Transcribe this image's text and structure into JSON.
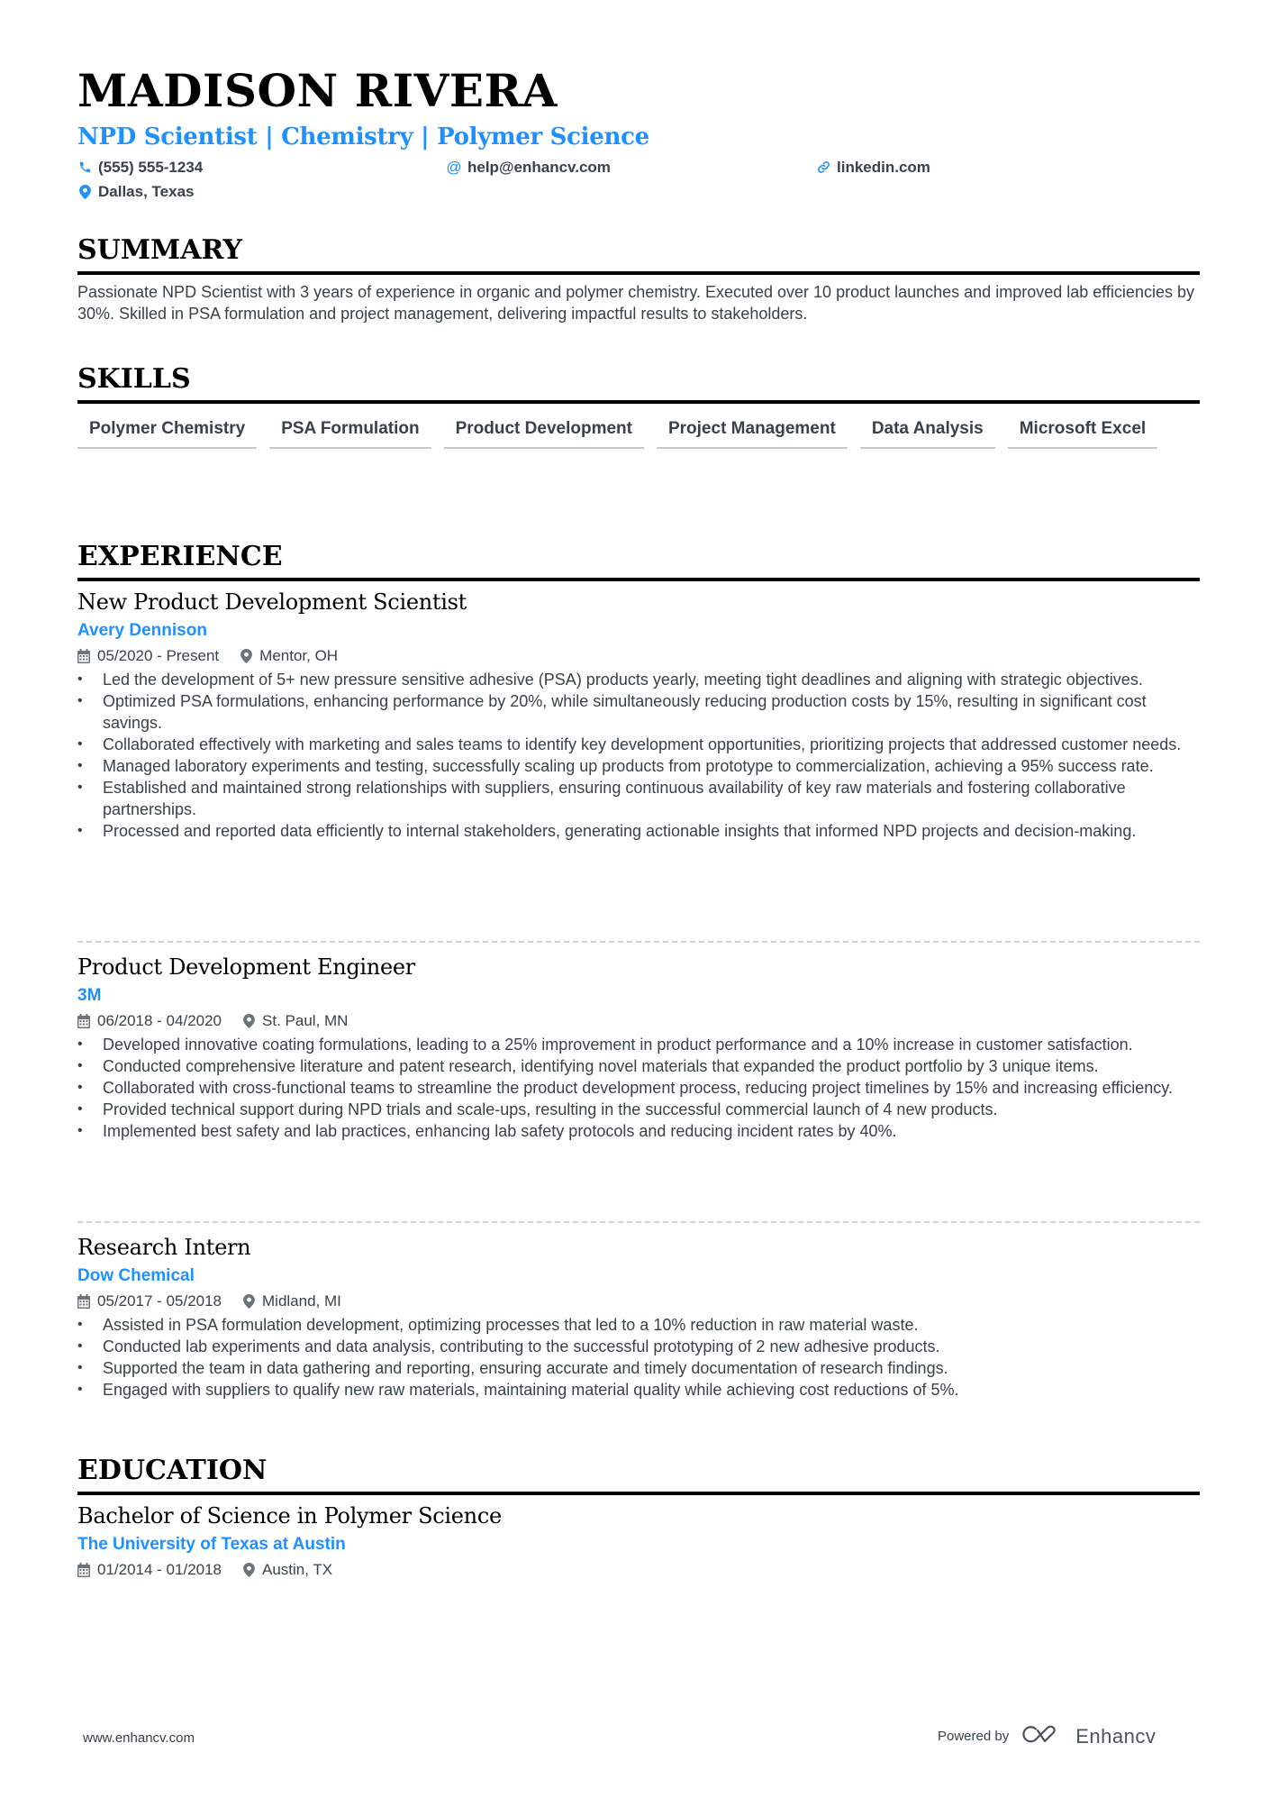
{
  "header": {
    "name": "MADISON RIVERA",
    "headline": "NPD Scientist | Chemistry | Polymer Science",
    "contacts": {
      "phone": {
        "icon": "phone-icon",
        "value": "(555) 555-1234"
      },
      "email": {
        "icon": "at-icon",
        "value": "help@enhancv.com"
      },
      "link": {
        "icon": "link-icon",
        "value": "linkedin.com"
      },
      "location": {
        "icon": "location-pin-icon",
        "value": "Dallas, Texas"
      }
    }
  },
  "colors": {
    "accent": "#1e90ff",
    "text": "#384347",
    "heading": "#000000",
    "skill_underline": "#c8c8c8",
    "separator": "#d3d3d3"
  },
  "summary": {
    "title": "SUMMARY",
    "text": "Passionate NPD Scientist with 3 years of experience in organic and polymer chemistry. Executed over 10 product launches and improved lab efficiencies by 30%. Skilled in PSA formulation and project management, delivering impactful results to stakeholders."
  },
  "skills": {
    "title": "SKILLS",
    "items": [
      "Polymer Chemistry",
      "PSA Formulation",
      "Product Development",
      "Project Management",
      "Data Analysis",
      "Microsoft Excel"
    ]
  },
  "experience": {
    "title": "EXPERIENCE",
    "items": [
      {
        "role": "New Product Development Scientist",
        "company": "Avery Dennison",
        "dates": "05/2020 - Present",
        "location": "Mentor, OH",
        "bullets": [
          "Led the development of 5+ new pressure sensitive adhesive (PSA) products yearly, meeting tight deadlines and aligning with strategic objectives.",
          "Optimized PSA formulations, enhancing performance by 20%, while simultaneously reducing production costs by 15%, resulting in significant cost savings.",
          "Collaborated effectively with marketing and sales teams to identify key development opportunities, prioritizing projects that addressed customer needs.",
          "Managed laboratory experiments and testing, successfully scaling up products from prototype to commercialization, achieving a 95% success rate.",
          "Established and maintained strong relationships with suppliers, ensuring continuous availability of key raw materials and fostering collaborative partnerships.",
          "Processed and reported data efficiently to internal stakeholders, generating actionable insights that informed NPD projects and decision-making."
        ]
      },
      {
        "role": "Product Development Engineer",
        "company": "3M",
        "dates": "06/2018 - 04/2020",
        "location": "St. Paul, MN",
        "bullets": [
          "Developed innovative coating formulations, leading to a 25% improvement in product performance and a 10% increase in customer satisfaction.",
          "Conducted comprehensive literature and patent research, identifying novel materials that expanded the product portfolio by 3 unique items.",
          "Collaborated with cross-functional teams to streamline the product development process, reducing project timelines by 15% and increasing efficiency.",
          "Provided technical support during NPD trials and scale-ups, resulting in the successful commercial launch of 4 new products.",
          "Implemented best safety and lab practices, enhancing lab safety protocols and reducing incident rates by 40%."
        ]
      },
      {
        "role": "Research Intern",
        "company": "Dow Chemical",
        "dates": "05/2017 - 05/2018",
        "location": "Midland, MI",
        "bullets": [
          "Assisted in PSA formulation development, optimizing processes that led to a 10% reduction in raw material waste.",
          "Conducted lab experiments and data analysis, contributing to the successful prototyping of 2 new adhesive products.",
          "Supported the team in data gathering and reporting, ensuring accurate and timely documentation of research findings.",
          "Engaged with suppliers to qualify new raw materials, maintaining material quality while achieving cost reductions of 5%."
        ]
      }
    ]
  },
  "education": {
    "title": "EDUCATION",
    "items": [
      {
        "degree": "Bachelor of Science in Polymer Science",
        "school": "The University of Texas at Austin",
        "dates": "01/2014 - 01/2018",
        "location": "Austin, TX"
      }
    ]
  },
  "footer": {
    "website": "www.enhancv.com",
    "powered_by": "Powered by",
    "brand": "Enhancv"
  }
}
